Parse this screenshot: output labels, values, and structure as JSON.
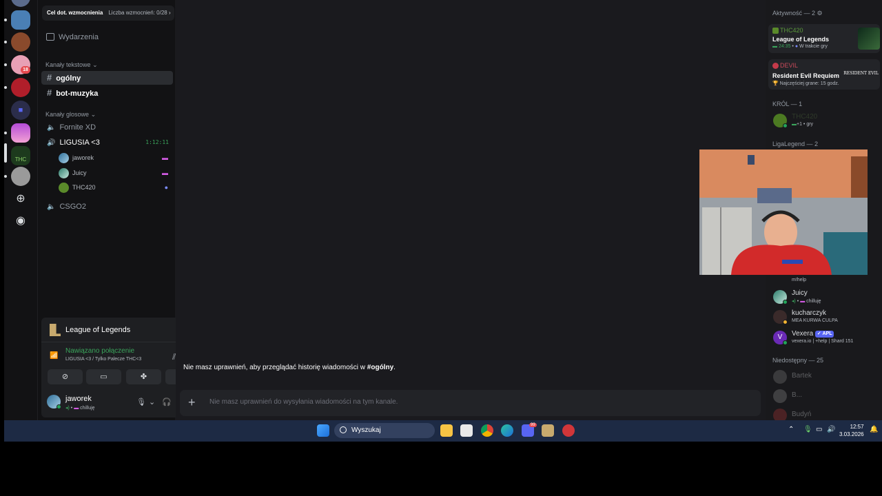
{
  "boost_bar": {
    "goal_label": "Cel dot. wzmocnienia",
    "count_label": "Liczba wzmocnień: 0/28"
  },
  "sidebar": {
    "events_label": "Wydarzenia",
    "text_category": "Kanały tekstowe",
    "text_channels": [
      {
        "name": "ogólny",
        "active": true
      },
      {
        "name": "bot-muzyka",
        "active": false
      }
    ],
    "voice_category": "Kanały glosowe",
    "voice_channels": [
      {
        "name": "Fornite XD"
      },
      {
        "name": "LIGUSIA <3",
        "timer": "1:12:11"
      },
      {
        "name": "CSGO2"
      }
    ],
    "voice_users": [
      {
        "name": "jaworek"
      },
      {
        "name": "Juicy"
      },
      {
        "name": "THC420"
      }
    ],
    "server_badges": {
      "count": "18",
      "thc_label": "THC"
    }
  },
  "voice_panel": {
    "game_title": "League of Legends",
    "status": "Nawiązano połączenie",
    "channel_path": "LIGUSIA <3 / Tylko Palecze THC<3"
  },
  "user_panel": {
    "username": "jaworek",
    "status_text": "chilluję"
  },
  "chat": {
    "no_history_prefix": "Nie masz uprawnień, aby przeglądać historię wiadomości w ",
    "no_history_channel": "#ogólny",
    "no_history_suffix": ".",
    "composer_placeholder": "Nie masz uprawnień do wysyłania wiadomości na tym kanale."
  },
  "members": {
    "activity_header": "Aktywność — 2",
    "activities": [
      {
        "user": "THC420",
        "game": "League of Legends",
        "detail_time": "24:35",
        "detail_text": "W trakcie gry"
      },
      {
        "user": "DEVIL",
        "game": "Resident Evil Requiem",
        "detail_text": "Najczęściej grane: 15 godz."
      }
    ],
    "logo_text": "RESIDENT EVIL",
    "krol_header": "KRÓL — 1",
    "krol_member": {
      "name": "THC420",
      "status": "+1 • gry"
    },
    "liga_header": "LigaLegend — 2",
    "online_members": [
      {
        "name": "",
        "status": "m!help"
      },
      {
        "name": "Juicy",
        "status": "chilluję"
      },
      {
        "name": "kucharczyk",
        "status": "MEA KURWA CULPA"
      },
      {
        "name": "Vexera",
        "tag": "APL",
        "status": "vexera.io | +help | Shard 151"
      }
    ],
    "offline_header": "Niedostępny — 25",
    "offline_members": [
      {
        "name": "Bartek"
      },
      {
        "name": "B..."
      },
      {
        "name": "Budyń"
      }
    ]
  },
  "taskbar": {
    "search_label": "Wyszukaj",
    "discord_badge": "99",
    "time": "12:57",
    "date": "3.03.2026"
  }
}
